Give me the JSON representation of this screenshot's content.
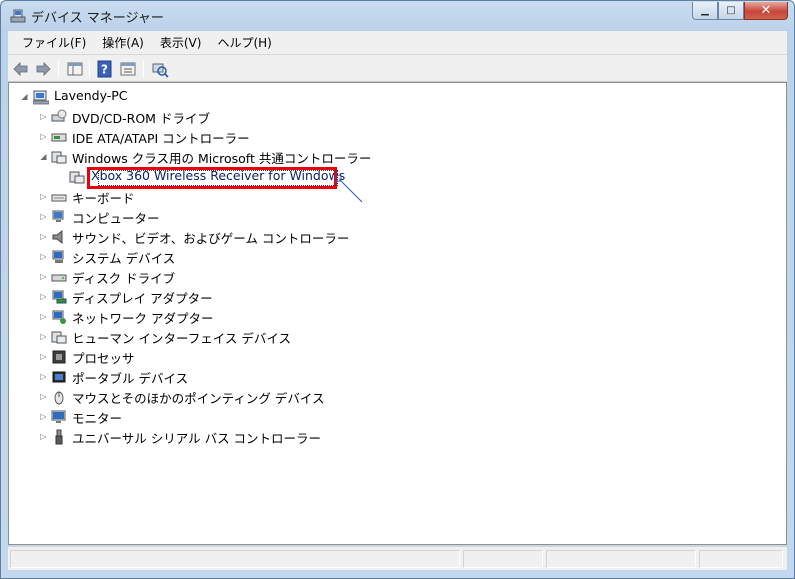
{
  "window": {
    "title": "デバイス マネージャー",
    "buttons": {
      "minimize": "▁",
      "maximize": "□",
      "close": "✕"
    }
  },
  "menu": [
    {
      "label": "ファイル(F)"
    },
    {
      "label": "操作(A)"
    },
    {
      "label": "表示(V)"
    },
    {
      "label": "ヘルプ(H)"
    }
  ],
  "toolbar": [
    {
      "icon": "back-arrow-icon"
    },
    {
      "icon": "forward-arrow-icon"
    },
    {
      "icon": "show-hide-console-tree-icon"
    },
    {
      "icon": "help-icon"
    },
    {
      "icon": "properties-icon"
    },
    {
      "icon": "scan-hardware-changes-icon"
    }
  ],
  "tree": {
    "root": {
      "label": "Lavendy-PC",
      "icon": "computer-icon"
    },
    "items": [
      {
        "label": "DVD/CD-ROM ドライブ",
        "icon": "dvd-drive-icon",
        "expanded": false
      },
      {
        "label": "IDE ATA/ATAPI コントローラー",
        "icon": "ide-controller-icon",
        "expanded": false
      },
      {
        "label": "Windows クラス用の Microsoft 共通コントローラー",
        "icon": "controller-icon",
        "expanded": true,
        "children": [
          {
            "label": "Xbox 360 Wireless Receiver for Windows",
            "icon": "controller-device-icon",
            "selected": true
          }
        ]
      },
      {
        "label": "キーボード",
        "icon": "keyboard-icon",
        "expanded": false
      },
      {
        "label": "コンピューター",
        "icon": "computer-icon",
        "expanded": false
      },
      {
        "label": "サウンド、ビデオ、およびゲーム コントローラー",
        "icon": "speaker-icon",
        "expanded": false
      },
      {
        "label": "システム デバイス",
        "icon": "system-device-icon",
        "expanded": false
      },
      {
        "label": "ディスク ドライブ",
        "icon": "disk-drive-icon",
        "expanded": false
      },
      {
        "label": "ディスプレイ アダプター",
        "icon": "display-adapter-icon",
        "expanded": false
      },
      {
        "label": "ネットワーク アダプター",
        "icon": "network-adapter-icon",
        "expanded": false
      },
      {
        "label": "ヒューマン インターフェイス デバイス",
        "icon": "hid-icon",
        "expanded": false
      },
      {
        "label": "プロセッサ",
        "icon": "processor-icon",
        "expanded": false
      },
      {
        "label": "ポータブル デバイス",
        "icon": "portable-device-icon",
        "expanded": false
      },
      {
        "label": "マウスとそのほかのポインティング デバイス",
        "icon": "mouse-icon",
        "expanded": false
      },
      {
        "label": "モニター",
        "icon": "monitor-icon",
        "expanded": false
      },
      {
        "label": "ユニバーサル シリアル バス コントローラー",
        "icon": "usb-icon",
        "expanded": false
      }
    ]
  },
  "colors": {
    "highlight_box": "#e8000d",
    "window_frame": "#c3d8ee",
    "selected_text": "#0a246a"
  }
}
